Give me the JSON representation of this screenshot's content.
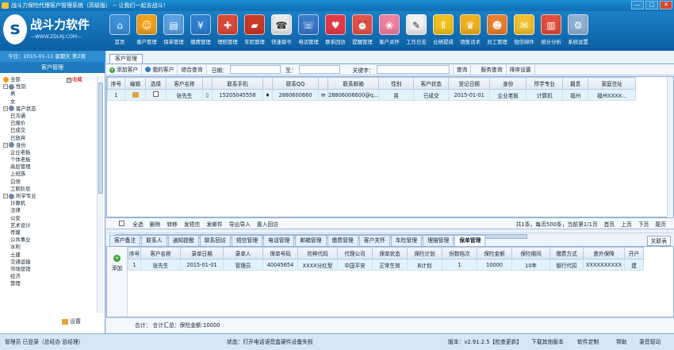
{
  "window": {
    "title": "战斗力保险代理客户管理系统（高级版） -- 让我们一起去战斗！",
    "btn_min": "—",
    "btn_max": "□",
    "btn_close": "✕"
  },
  "logo": {
    "mark": "s",
    "name": "战斗力软件",
    "url": "—WWW.ZDLRJ.COM—"
  },
  "date": {
    "text": "今日：2015-01-11 星期天 第2周"
  },
  "toolbar": [
    {
      "label": "首页",
      "color": "#3d8fd6",
      "glyph": "⌂"
    },
    {
      "label": "客户管理",
      "color": "#f0a020",
      "glyph": "☺"
    },
    {
      "label": "保单管理",
      "color": "#5aa0e0",
      "glyph": "▤"
    },
    {
      "label": "缴费管理",
      "color": "#2f7fd0",
      "glyph": "¥"
    },
    {
      "label": "理赔管理",
      "color": "#d84a3a",
      "glyph": "✚"
    },
    {
      "label": "车险管理",
      "color": "#c83a2a",
      "glyph": "▰"
    },
    {
      "label": "快速拨号",
      "color": "#e9e9e9",
      "glyph": "☎"
    },
    {
      "label": "电话管理",
      "color": "#3a78c8",
      "glyph": "☏"
    },
    {
      "label": "联系回访",
      "color": "#e33a4a",
      "glyph": "♥"
    },
    {
      "label": "提醒管理",
      "color": "#e2534a",
      "glyph": "⏰"
    },
    {
      "label": "客户关怀",
      "color": "#f07fa0",
      "glyph": "❀"
    },
    {
      "label": "工作日志",
      "color": "#f1f1f1",
      "glyph": "✎"
    },
    {
      "label": "业绩提成",
      "color": "#f0c020",
      "glyph": "Ⅱ"
    },
    {
      "label": "销售话术",
      "color": "#f0b020",
      "glyph": "♛"
    },
    {
      "label": "员工管理",
      "color": "#e98030",
      "glyph": "☻"
    },
    {
      "label": "短信邮件",
      "color": "#f0c030",
      "glyph": "✉"
    },
    {
      "label": "统计分析",
      "color": "#e0503a",
      "glyph": "▥"
    },
    {
      "label": "系统设置",
      "color": "#8fb0d0",
      "glyph": "⚙"
    }
  ],
  "left": {
    "title": "客户管理",
    "tree": [
      {
        "label": "全部",
        "level": 0,
        "icon": "all"
      },
      {
        "label": "性别",
        "level": 0,
        "tw": "−"
      },
      {
        "label": "男",
        "level": 1
      },
      {
        "label": "女",
        "level": 1
      },
      {
        "label": "客户状态",
        "level": 0,
        "tw": "−"
      },
      {
        "label": "已沟通",
        "level": 1
      },
      {
        "label": "已报价",
        "level": 1
      },
      {
        "label": "已成交",
        "level": 1
      },
      {
        "label": "已放弃",
        "level": 1
      },
      {
        "label": "身份",
        "level": 0,
        "tw": "−"
      },
      {
        "label": "企业老板",
        "level": 1
      },
      {
        "label": "个体老板",
        "level": 1
      },
      {
        "label": "高层管理",
        "level": 1
      },
      {
        "label": "上班族",
        "level": 1
      },
      {
        "label": "白领",
        "level": 1
      },
      {
        "label": "工薪阶层",
        "level": 1
      },
      {
        "label": "所学专业",
        "level": 0,
        "tw": "−"
      },
      {
        "label": "计算机",
        "level": 1
      },
      {
        "label": "法律",
        "level": 1
      },
      {
        "label": "公安",
        "level": 1
      },
      {
        "label": "艺术设计",
        "level": 1
      },
      {
        "label": "传媒",
        "level": 1
      },
      {
        "label": "公共事业",
        "level": 1
      },
      {
        "label": "水利",
        "level": 1
      },
      {
        "label": "土建",
        "level": 1
      },
      {
        "label": "交通运输",
        "level": 1
      },
      {
        "label": "市场营销",
        "level": 1
      },
      {
        "label": "经济",
        "level": 1
      },
      {
        "label": "管理",
        "level": 1
      }
    ],
    "fav": "收藏",
    "fav_tw": "+",
    "settings": "设置"
  },
  "main": {
    "tab": "客户管理",
    "filter": {
      "add": "添加客户",
      "my": "我的客户",
      "search_all": "综合查询",
      "date": "日期：",
      "to": "至：",
      "keyword": "关键字：",
      "query": "查询",
      "service": "服务查询",
      "sort": "排序设置"
    },
    "columns": [
      "序号",
      "编辑",
      "选择",
      "客户名称",
      "",
      "联系手机",
      "",
      "联系QQ",
      "",
      "联系邮箱",
      "性别",
      "客户状态",
      "登记日期",
      "身份",
      "所学专业",
      "籍贯",
      "家庭住址"
    ],
    "rows": [
      [
        "1",
        "",
        "",
        "张先生",
        "▯",
        "15205045558",
        "♦",
        "2880600660",
        "✉",
        "28806006600@q...",
        "男",
        "已成交",
        "2015-01-01",
        "企业老板",
        "计算机",
        "福州",
        "福州XXXX..."
      ]
    ],
    "actions": {
      "select_all": "全选",
      "delete": "删除",
      "transfer": "转移",
      "send_sms": "发短信",
      "send_mail": "发邮件",
      "export": "导出导入",
      "import_calls": "置入回访",
      "page_info": "共1条，每页500条，当前第1/1页",
      "first": "首页",
      "prev": "上页",
      "next": "下页",
      "last": "尾页"
    },
    "subtabs": [
      "客户备注",
      "联系人",
      "通知提醒",
      "联系回访",
      "短信管理",
      "电话管理",
      "邮箱管理",
      "缴费管理",
      "客户关怀",
      "车险管理",
      "理赔管理",
      "保单管理"
    ],
    "active_subtab": 11,
    "link_btn": "关联表",
    "add_label": "添加",
    "add_glyph": "+",
    "sub_columns": [
      "序号",
      "客户名称",
      "录单日期",
      "录单人",
      "保单号码",
      "险种代码",
      "代理公司",
      "保单状态",
      "保险计划",
      "份数档次",
      "保险金额",
      "保险期间",
      "缴费方式",
      "意外保障",
      "开户"
    ],
    "sub_rows": [
      [
        "1",
        "张先生",
        "2015-01-01",
        "管理员",
        "40045654",
        "XXXX分红型",
        "中国平安",
        "正常生效",
        "B计划",
        "1",
        "10000",
        "10年",
        "银行代扣",
        "XXXXXXXXXX",
        "建"
      ]
    ],
    "summary": "合计：    合计汇总：保险金额:10000"
  },
  "status": {
    "user": "管理员 已登录（总经办 总经理）",
    "state": "状态：打开电话语音盒硬件设备失败",
    "version": "版本：v2.91.2.5【检查更新】",
    "download": "下载其他版本",
    "custom": "软件定制",
    "help": "帮助",
    "record": "录音驱动"
  }
}
